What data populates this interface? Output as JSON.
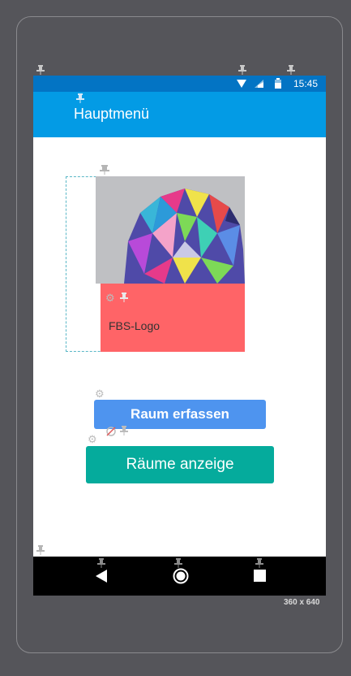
{
  "status_bar": {
    "time": "15:45",
    "bg_color": "#0374c4"
  },
  "app_bar": {
    "title": "Hauptmenü",
    "bg_color": "#039be5"
  },
  "logo": {
    "label": "FBS-Logo",
    "label_bg_color": "#ff6467"
  },
  "buttons": {
    "raum_erfassen": {
      "label": "Raum erfassen",
      "color": "#4e94ef"
    },
    "raeume_anzeige": {
      "label": "Räume anzeige",
      "color": "#05ab9c"
    }
  },
  "nav_bar": {
    "icons": [
      "back-icon",
      "home-icon",
      "recents-icon"
    ]
  },
  "preview": {
    "dimensions": "360 x 640"
  }
}
